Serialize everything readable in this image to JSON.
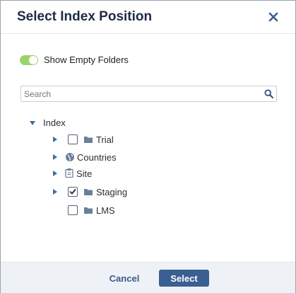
{
  "dialog": {
    "title": "Select Index Position",
    "close_icon": "close-icon"
  },
  "toggle": {
    "label": "Show Empty Folders",
    "on": true,
    "color": "#9bd46b"
  },
  "search": {
    "placeholder": "Search",
    "value": ""
  },
  "tree": {
    "root": {
      "label": "Index",
      "expanded": true
    },
    "items": [
      {
        "label": "Trial",
        "icon": "folder-icon",
        "checkbox": true,
        "checked": false,
        "expander": true
      },
      {
        "label": "Countries",
        "icon": "globe-icon",
        "checkbox": false,
        "checked": false,
        "expander": true
      },
      {
        "label": "Site",
        "icon": "clipboard-icon",
        "checkbox": false,
        "checked": false,
        "expander": true
      },
      {
        "label": "Staging",
        "icon": "folder-icon",
        "checkbox": true,
        "checked": true,
        "expander": true
      },
      {
        "label": "LMS",
        "icon": "folder-icon",
        "checkbox": true,
        "checked": false,
        "expander": false
      }
    ]
  },
  "footer": {
    "cancel_label": "Cancel",
    "select_label": "Select",
    "accent": "#3a5f92"
  }
}
